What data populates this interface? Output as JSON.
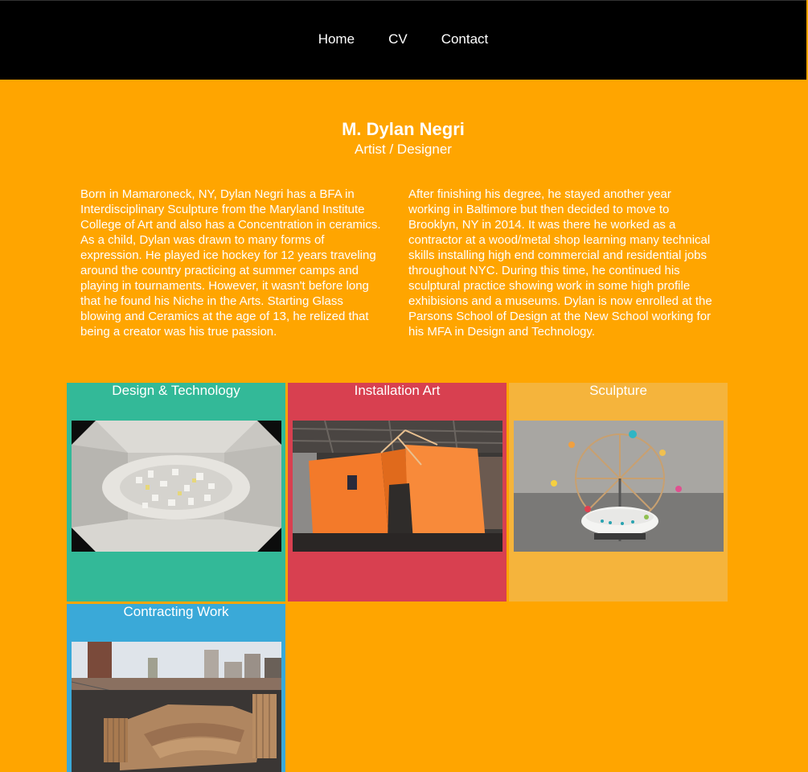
{
  "nav": {
    "items": [
      "Home",
      "CV",
      "Contact"
    ]
  },
  "header": {
    "name": "M. Dylan Negri",
    "role": "Artist / Designer"
  },
  "bio": {
    "left": "Born in Mamaroneck, NY, Dylan Negri has a BFA in Interdisciplinary Sculpture from the Maryland Institute College of Art and also has a Concentration in ceramics. As a child, Dylan was drawn to many forms of expression. He played ice hockey for 12 years traveling around the country practicing at summer camps and playing in tournaments. However, it wasn't before long that he found his Niche in the Arts. Starting Glass blowing and Ceramics at the age of 13, he relized that being a creator was his true passion.",
    "right": "After finishing his degree, he stayed another year working in Baltimore but then decided to move to Brooklyn, NY in 2014. It was there he worked as a contractor at a wood/metal shop learning many technical skills installing high end commercial and residential jobs throughout NYC. During this time, he continued his sculptural practice showing work in some high profile exhibisions and a museums. Dylan is now enrolled at the Parsons School of Design at the New School working for his MFA in Design and Technology."
  },
  "cards": [
    {
      "title": "Design & Technology",
      "color": "#33b998"
    },
    {
      "title": "Installation Art",
      "color": "#d84050"
    },
    {
      "title": "Sculpture",
      "color": "#f5b43c"
    },
    {
      "title": "Contracting Work",
      "color": "#3aa9d8"
    }
  ],
  "colors": {
    "page_background": "#ffa500",
    "navbar": "#000000",
    "text": "#ffffff"
  }
}
